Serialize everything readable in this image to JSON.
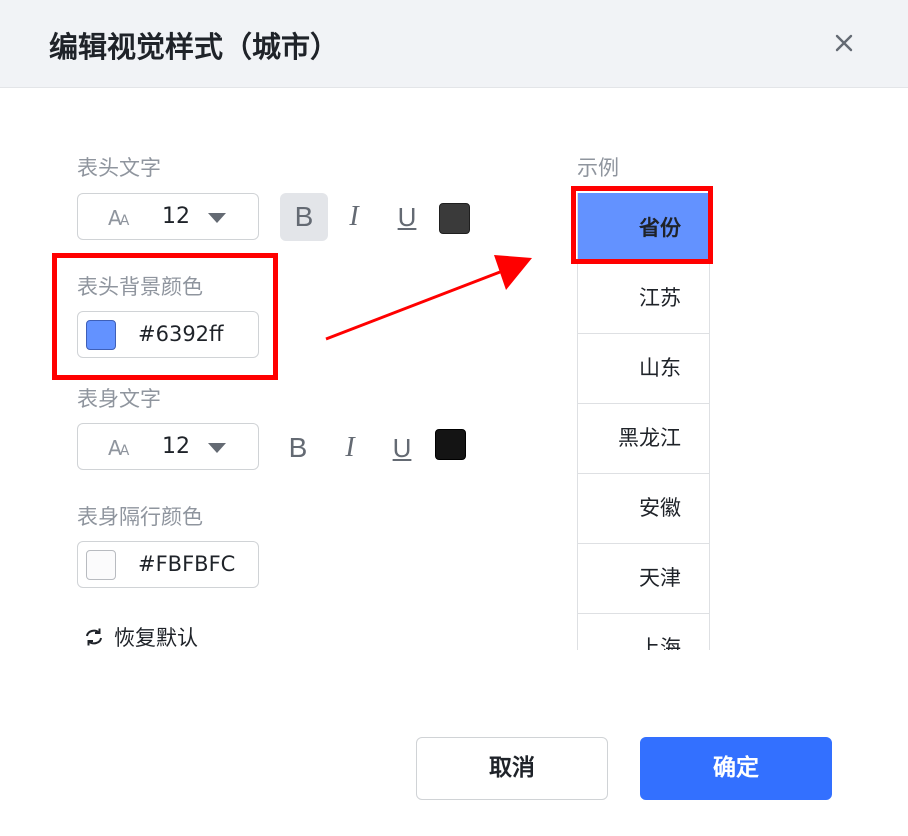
{
  "dialog": {
    "title": "编辑视觉样式（城市）"
  },
  "header_text": {
    "label": "表头文字",
    "font_size": "12",
    "font_icon": "Aa",
    "bold": "B",
    "italic": "I",
    "underline": "U",
    "bold_active": true,
    "color": "#3a3a3a"
  },
  "header_bg": {
    "label": "表头背景颜色",
    "color": "#6392ff",
    "value": "#6392ff"
  },
  "body_text": {
    "label": "表身文字",
    "font_size": "12",
    "font_icon": "Aa",
    "bold": "B",
    "italic": "I",
    "underline": "U",
    "color": "#141414"
  },
  "body_alt": {
    "label": "表身隔行颜色",
    "color": "#FBFBFC",
    "value": "#FBFBFC"
  },
  "restore": {
    "label": "恢复默认",
    "icon": "refresh-icon"
  },
  "example": {
    "label": "示例",
    "header": "省份",
    "rows": [
      "江苏",
      "山东",
      "黑龙江",
      "安徽",
      "天津",
      "上海"
    ]
  },
  "buttons": {
    "cancel": "取消",
    "ok": "确定"
  },
  "colors": {
    "accent": "#3370ff",
    "annotation": "#ff0000"
  }
}
